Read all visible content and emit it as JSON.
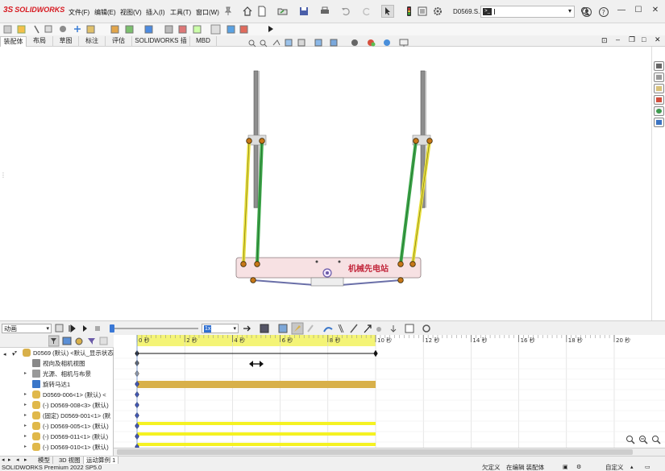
{
  "app": {
    "logo_text": "SOLIDWORKS",
    "document_title": "D0569.S...",
    "search_placeholder": ""
  },
  "menu": [
    {
      "label": "文件(F)"
    },
    {
      "label": "编辑(E)"
    },
    {
      "label": "视图(V)"
    },
    {
      "label": "插入(I)"
    },
    {
      "label": "工具(T)"
    },
    {
      "label": "窗口(W)"
    }
  ],
  "tabs": [
    {
      "label": "装配体",
      "active": true
    },
    {
      "label": "布局"
    },
    {
      "label": "草图"
    },
    {
      "label": "标注"
    },
    {
      "label": "评估"
    },
    {
      "label": "SOLIDWORKS 插件"
    },
    {
      "label": "MBD"
    }
  ],
  "viewport": {
    "watermark_text": "机械先电站",
    "icons": [
      "zoom-to-fit-icon",
      "zoom-area-icon",
      "previous-view-icon",
      "section-view-icon",
      "view-orientation-icon",
      "display-style-icon",
      "hide-show-icon",
      "appearance-icon",
      "scene-icon",
      "view-settings-icon",
      "monitor-icon"
    ]
  },
  "motion": {
    "study_type": "动画",
    "playback_speed": "1x",
    "playhead_seconds": 0
  },
  "timeline": {
    "ticks": [
      {
        "label": "0 秒"
      },
      {
        "label": "2 秒"
      },
      {
        "label": "4 秒"
      },
      {
        "label": "6 秒"
      },
      {
        "label": "8 秒"
      },
      {
        "label": "10 秒"
      },
      {
        "label": "12 秒"
      },
      {
        "label": "14 秒"
      },
      {
        "label": "16 秒"
      },
      {
        "label": "18 秒"
      },
      {
        "label": "20 秒"
      }
    ],
    "duration_seconds": 10
  },
  "tree": [
    {
      "label": "D0569 (默认) <默认_显示状态",
      "icon": "assembly-icon",
      "expanded": true,
      "level": 0
    },
    {
      "label": "视向及相机视图",
      "icon": "camera-icon",
      "level": 1
    },
    {
      "label": "光源、相机与布景",
      "icon": "lights-icon",
      "level": 1,
      "expandable": true
    },
    {
      "label": "旋转马达1",
      "icon": "motor-icon",
      "level": 1
    },
    {
      "label": "D0569-006<1> (默认) <",
      "icon": "part-icon",
      "level": 1,
      "expandable": true
    },
    {
      "label": "(-) D0569-008<3> (默认)",
      "icon": "part-icon",
      "level": 1,
      "expandable": true
    },
    {
      "label": "(固定) D0569-001<1> (默",
      "icon": "part-icon",
      "level": 1,
      "expandable": true
    },
    {
      "label": "(-) D0569-005<1> (默认)",
      "icon": "part-icon",
      "level": 1,
      "expandable": true
    },
    {
      "label": "(-) D0569-011<1> (默认)",
      "icon": "part-icon",
      "level": 1,
      "expandable": true
    },
    {
      "label": "(-) D0569-010<1> (默认)",
      "icon": "part-icon",
      "level": 1,
      "expandable": true
    }
  ],
  "bottom_tabs": [
    {
      "label": "模型"
    },
    {
      "label": "3D 视图"
    },
    {
      "label": "运动算例 1",
      "active": true
    }
  ],
  "status": {
    "product": "SOLIDWORKS Premium 2022 SP5.0",
    "state": "欠定义",
    "mode": "在编辑 装配体",
    "units": "自定义"
  },
  "colors": {
    "accent": "#d71920",
    "timeline_band": "#f4f476",
    "bar_gold": "#d8b04a",
    "bar_yellow": "#f5f222",
    "link_yellow": "#e8df3c",
    "link_green": "#3da84a",
    "base_plate": "#f7e1e3"
  }
}
